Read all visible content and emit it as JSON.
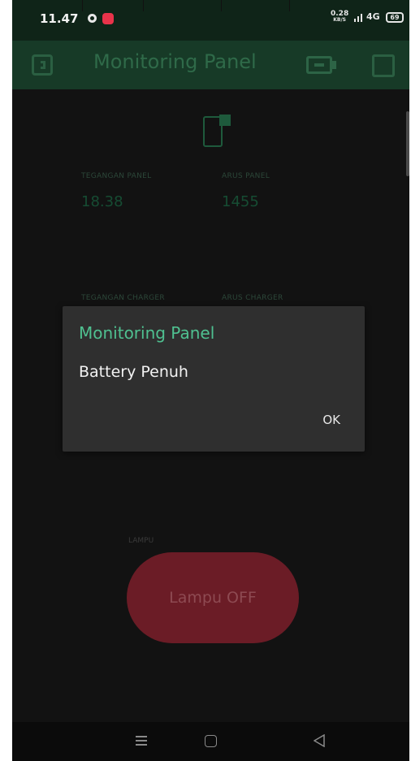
{
  "status_bar": {
    "time": "11.47",
    "speed_value": "0.28",
    "speed_unit": "KB/S",
    "network": "4G",
    "battery": "69"
  },
  "app_bar": {
    "title": "Monitoring Panel",
    "left_icon": "exit-icon",
    "device_icon": "device-icon",
    "right_icon": "square-icon"
  },
  "widgets": {
    "tegangan_panel": {
      "label": "TEGANGAN PANEL",
      "value": "18.38"
    },
    "arus_panel": {
      "label": "ARUS PANEL",
      "value": "1455"
    },
    "tegangan_charger": {
      "label": "TEGANGAN CHARGER"
    },
    "arus_charger": {
      "label": "ARUS CHARGER"
    },
    "lampu": {
      "label": "LAMPU",
      "button_label": "Lampu OFF"
    }
  },
  "dialog": {
    "title": "Monitoring Panel",
    "message": "Battery Penuh",
    "ok_label": "OK"
  },
  "colors": {
    "accent": "#4fc090",
    "app_bar": "#173a27",
    "lamp_button": "#6b1c26"
  }
}
